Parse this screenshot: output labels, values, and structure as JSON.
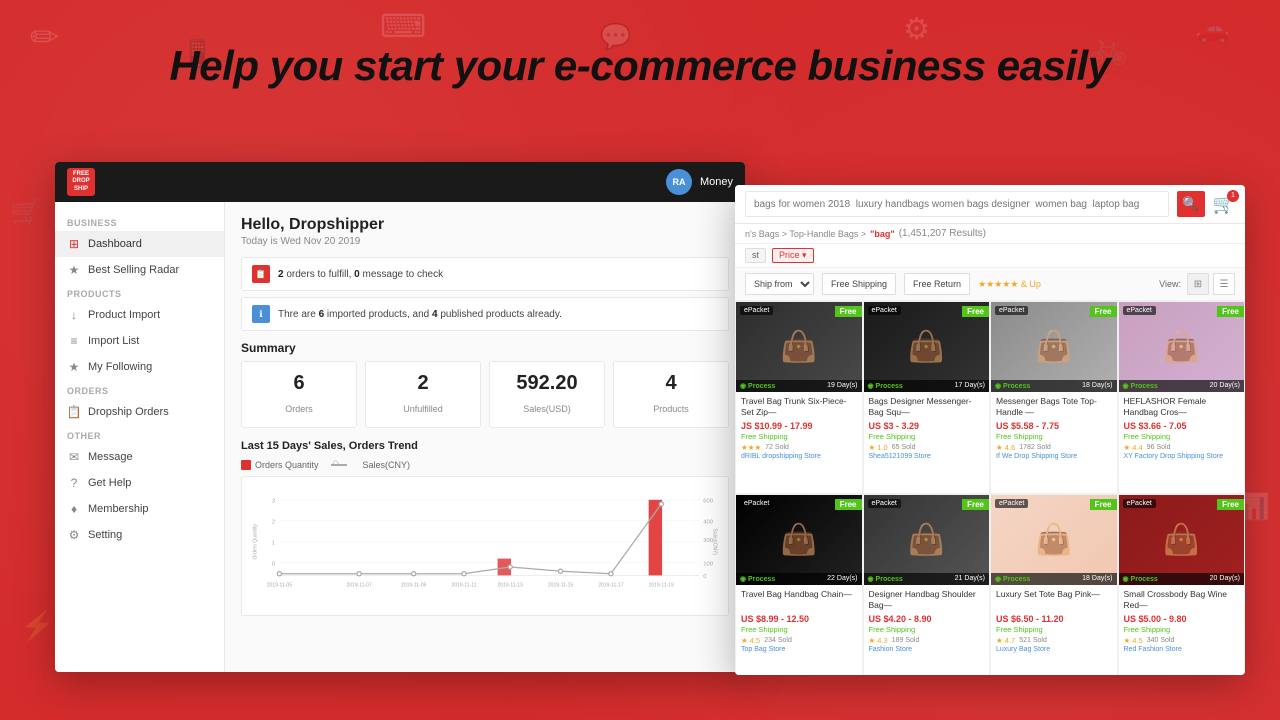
{
  "page": {
    "headline": "Help you start your e-commerce business easily"
  },
  "dashboard": {
    "header": {
      "logo_line1": "FREE",
      "logo_line2": "DROPSHIP",
      "avatar_initials": "RA",
      "money_label": "Money"
    },
    "sidebar": {
      "business_label": "BUSINESS",
      "items_business": [
        {
          "id": "dashboard",
          "label": "Dashboard",
          "active": true
        },
        {
          "id": "best-selling",
          "label": "Best Selling Radar",
          "active": false
        }
      ],
      "products_label": "PRODUCTS",
      "items_products": [
        {
          "id": "product-import",
          "label": "Product Import",
          "active": false
        },
        {
          "id": "import-list",
          "label": "Import List",
          "active": false
        },
        {
          "id": "my-following",
          "label": "My Following",
          "active": false
        }
      ],
      "orders_label": "ORDERS",
      "items_orders": [
        {
          "id": "dropship-orders",
          "label": "Dropship Orders",
          "active": false
        }
      ],
      "other_label": "OTHER",
      "items_other": [
        {
          "id": "message",
          "label": "Message",
          "active": false
        },
        {
          "id": "get-help",
          "label": "Get Help",
          "active": false
        },
        {
          "id": "membership",
          "label": "Membership",
          "active": false
        },
        {
          "id": "setting",
          "label": "Setting",
          "active": false
        }
      ]
    },
    "main": {
      "greeting": "Hello, Dropshipper",
      "date": "Today is Wed Nov 20 2019",
      "alert1": {
        "orders": "2",
        "messages": "0",
        "text1": " orders to fulfill, ",
        "text2": " message to check"
      },
      "alert2": {
        "imported": "6",
        "published": "4",
        "text1": "Thre are ",
        "text2": " imported products, and ",
        "text3": " published products already."
      },
      "summary_title": "Summary",
      "cards": [
        {
          "value": "6",
          "label": "Orders"
        },
        {
          "value": "2",
          "label": "Unfulfilled"
        },
        {
          "value": "592.20",
          "label": "Sales(USD)"
        },
        {
          "value": "4",
          "label": "Products"
        }
      ],
      "chart_title": "Last 15 Days' Sales, Orders Trend",
      "legend": [
        {
          "id": "orders-qty",
          "label": "Orders Quantity",
          "type": "bar"
        },
        {
          "id": "sales-cny",
          "label": "Sales(CNY)",
          "type": "line"
        }
      ],
      "chart_y_left_label": "Orders Quantity",
      "chart_y_right_label": "Sales(CNY)",
      "x_labels": [
        "2019-11-05",
        "2019-11-07",
        "2019-11-09",
        "2019-11-11",
        "2019-11-13",
        "2019-11-15",
        "2019-11-17",
        "2019-11-19"
      ]
    }
  },
  "ecommerce": {
    "search_placeholder": "bags for women 2018  luxury handbags women bags designer  women bag  laptop bag",
    "breadcrumb": "n's Bags > Top-Handle Bags > \"bag\" (1,451,207 Results)",
    "results_count": "1,451,207 Results",
    "keyword": "bag",
    "filter_options": [
      {
        "id": "ship-from",
        "label": "Ship from"
      },
      {
        "id": "free-shipping",
        "label": "Free Shipping"
      },
      {
        "id": "free-return",
        "label": "Free Return"
      }
    ],
    "star_filter": "★★★★★ & Up",
    "view_label": "View:",
    "search_tags": [
      {
        "label": "st",
        "active": false
      },
      {
        "label": "Price ▾",
        "active": true
      }
    ],
    "products": [
      {
        "id": "p1",
        "badge": "ePacket",
        "free_badge": "Free",
        "title": "Travel Bag Trunk Six-Piece-Set Zip—",
        "price": "JS $10.99 - 17.99",
        "shipping": "Free Shipping",
        "rating": "★★★",
        "sold": "72 Sold",
        "store": "dRIBL dropshipping Store",
        "process_days": "19 Day(s)",
        "bg_class": "bag-1"
      },
      {
        "id": "p2",
        "badge": "ePacket",
        "free_badge": "Free",
        "title": "Bags Designer Messenger-Bag Squ—",
        "price": "US $3 - 3.29",
        "shipping": "Free Shipping",
        "rating": "★ 1.0",
        "sold": "65 Sold",
        "store": "Shea5121099 Store",
        "process_days": "17 Day(s)",
        "bg_class": "bag-2"
      },
      {
        "id": "p3",
        "badge": "ePacket",
        "free_badge": "Free",
        "title": "Messenger Bags Tote Top-Handle —",
        "price": "US $5.58 - 7.75",
        "shipping": "Free Shipping",
        "rating": "★ 4.6",
        "sold": "1782 Sold",
        "store": "If We Drop Shipping Store",
        "process_days": "18 Day(s)",
        "bg_class": "bag-3"
      },
      {
        "id": "p4",
        "badge": "ePacket",
        "free_badge": "Free",
        "title": "HEFLASHOR Female Handbag Cros—",
        "price": "US $3.66 - 7.05",
        "shipping": "Free Shipping",
        "rating": "★ 4.4",
        "sold": "96 Sold",
        "store": "XY Factory Drop Shipping Store",
        "process_days": "20 Day(s)",
        "bg_class": "bag-4"
      },
      {
        "id": "p5",
        "badge": "ePacket",
        "free_badge": "Free",
        "title": "Travel Bag Handbag Chain—",
        "price": "US $8.99 - 12.50",
        "shipping": "Free Shipping",
        "rating": "★ 4.5",
        "sold": "234 Sold",
        "store": "Top Bag Store",
        "process_days": "22 Day(s)",
        "bg_class": "bag-5"
      },
      {
        "id": "p6",
        "badge": "ePacket",
        "free_badge": "Free",
        "title": "Designer Handbag Shoulder Bag—",
        "price": "US $4.20 - 8.90",
        "shipping": "Free Shipping",
        "rating": "★ 4.3",
        "sold": "189 Sold",
        "store": "Fashion Store",
        "process_days": "21 Day(s)",
        "bg_class": "bag-6"
      },
      {
        "id": "p7",
        "badge": "ePacket",
        "free_badge": "Free",
        "title": "Luxury Set Tote Bag Pink—",
        "price": "US $6.50 - 11.20",
        "shipping": "Free Shipping",
        "rating": "★ 4.7",
        "sold": "521 Sold",
        "store": "Luxury Bag Store",
        "process_days": "18 Day(s)",
        "bg_class": "bag-7"
      },
      {
        "id": "p8",
        "badge": "ePacket",
        "free_badge": "Free",
        "title": "Small Crossbody Bag Wine Red—",
        "price": "US $5.00 - 9.80",
        "shipping": "Free Shipping",
        "rating": "★ 4.5",
        "sold": "340 Sold",
        "store": "Red Fashion Store",
        "process_days": "20 Day(s)",
        "bg_class": "bag-8"
      }
    ]
  }
}
